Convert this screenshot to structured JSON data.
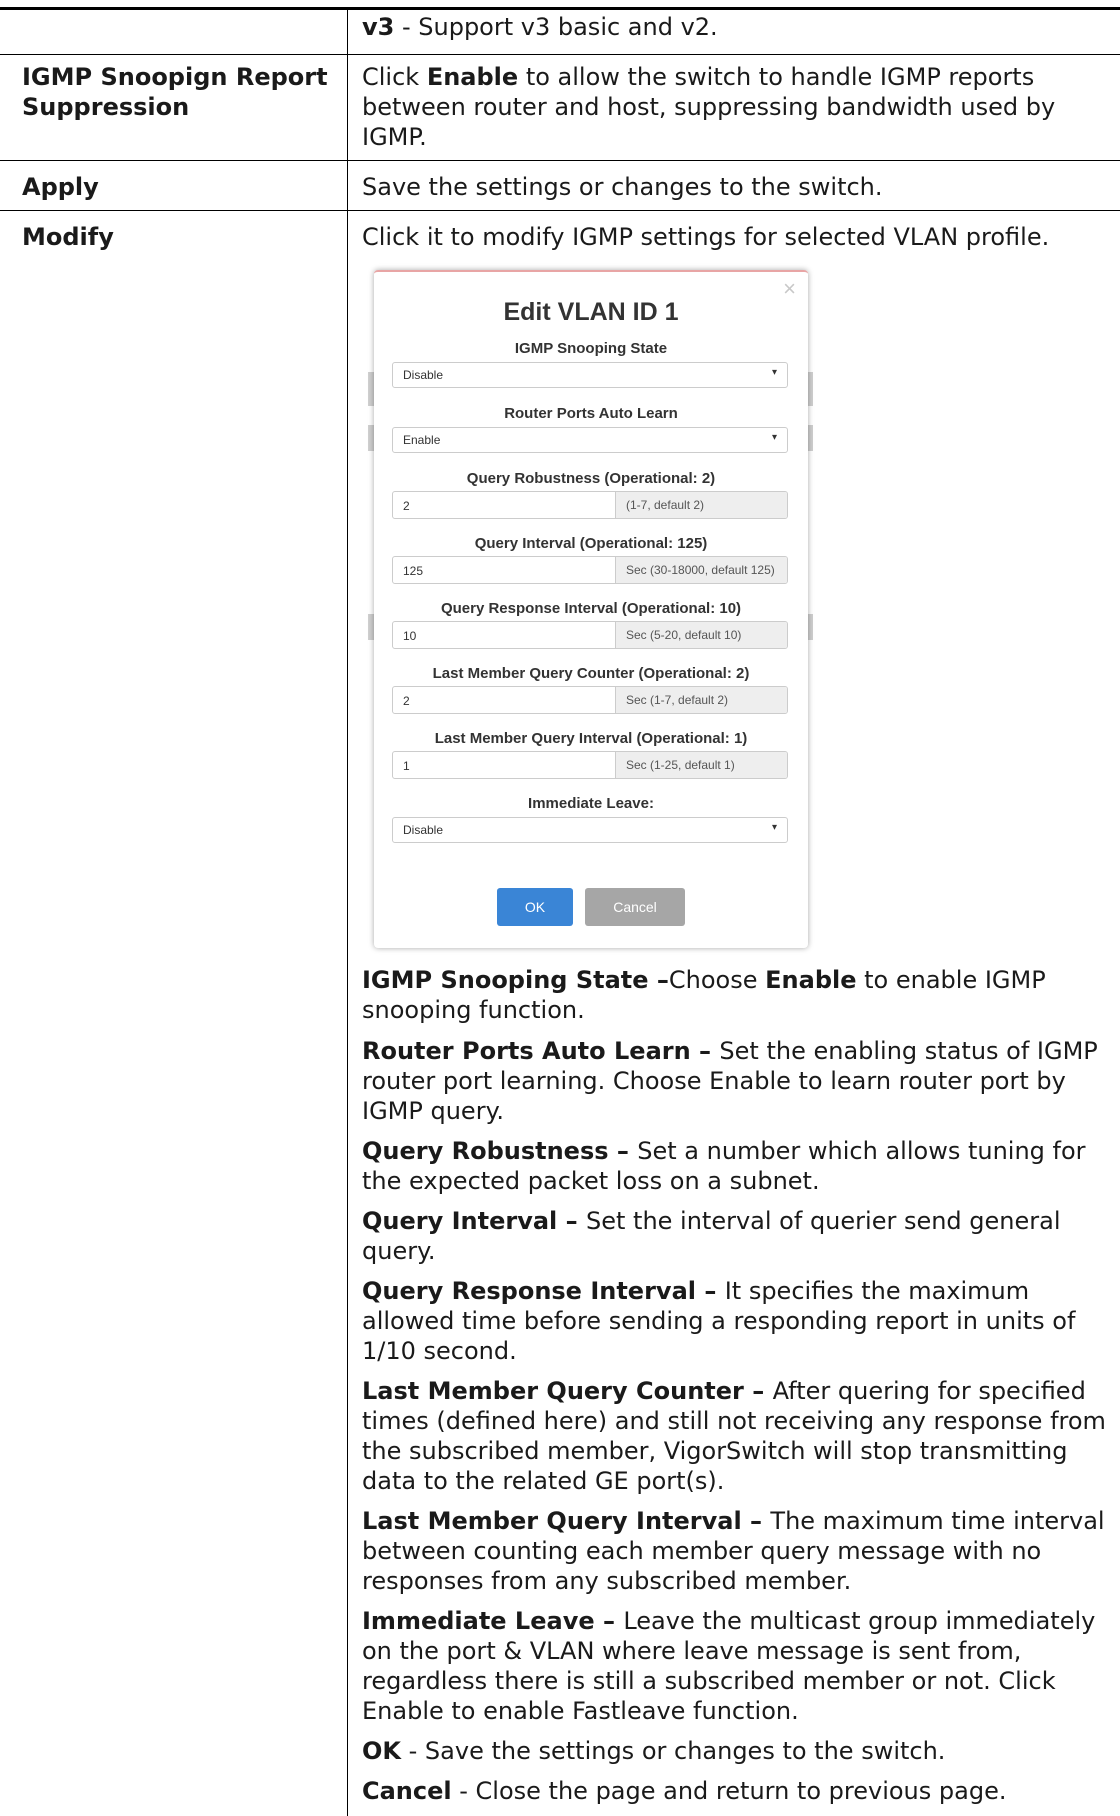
{
  "rows": {
    "versions": {
      "v3_term": "v3",
      "v3_text": " - Support v3 basic and v2."
    },
    "report_suppression": {
      "label": "IGMP Snoopign Report Suppression",
      "desc_pre": "Click ",
      "desc_bold": "Enable",
      "desc_post": " to allow the switch to handle IGMP reports between router and host, suppressing bandwidth used by IGMP."
    },
    "apply": {
      "label": "Apply",
      "desc": "Save the settings or changes to the switch."
    },
    "modify": {
      "label": "Modify",
      "desc": "Click it to modify IGMP settings for selected VLAN profile."
    }
  },
  "dialog": {
    "title": "Edit VLAN ID 1",
    "close": "×",
    "snooping_state": {
      "label": "IGMP Snooping State",
      "value": "Disable"
    },
    "auto_learn": {
      "label": "Router Ports Auto Learn",
      "value": "Enable"
    },
    "robustness": {
      "label": "Query Robustness (Operational: 2)",
      "value": "2",
      "hint": "(1-7, default 2)"
    },
    "interval": {
      "label": "Query Interval (Operational: 125)",
      "value": "125",
      "hint": "Sec (30-18000, default 125)"
    },
    "response": {
      "label": "Query Response Interval (Operational: 10)",
      "value": "10",
      "hint": "Sec (5-20, default 10)"
    },
    "lm_counter": {
      "label": "Last Member Query Counter (Operational: 2)",
      "value": "2",
      "hint": "Sec (1-7, default 2)"
    },
    "lm_interval": {
      "label": "Last Member Query Interval (Operational: 1)",
      "value": "1",
      "hint": "Sec (1-25, default 1)"
    },
    "immediate_leave": {
      "label": "Immediate Leave:",
      "value": "Disable"
    },
    "ok": "OK",
    "cancel": "Cancel"
  },
  "descriptions": [
    {
      "term": "IGMP Snooping State",
      "sep": " –",
      "pre": "Choose ",
      "bold": "Enable",
      "post": " to enable IGMP snooping function."
    },
    {
      "term": "Router Ports Auto Learn",
      "sep": " – ",
      "text": "Set the enabling status of IGMP router port learning. Choose Enable to learn router port by IGMP query."
    },
    {
      "term": "Query Robustness",
      "sep": " – ",
      "text": "Set a number which allows tuning for the expected packet loss on a subnet."
    },
    {
      "term": "Query Interval",
      "sep": " – ",
      "text": "Set the interval of querier send general query."
    },
    {
      "term": "Query Response Interval",
      "sep": " – ",
      "text": "It specifies the maximum allowed time before sending a responding report in units of 1/10 second."
    },
    {
      "term": "Last Member Query Counter",
      "sep": " – ",
      "text": "After quering for specified times (defined here) and still not receiving any response from the subscribed member, VigorSwitch will stop transmitting data to the related GE port(s)."
    },
    {
      "term": "Last Member Query Interval",
      "sep": " – ",
      "text": "The maximum time interval between counting each member query message with no responses from any subscribed member."
    },
    {
      "term": "Immediate Leave",
      "sep": " – ",
      "text": "Leave the multicast group immediately on the port & VLAN where leave message is sent from, regardless there is still a subscribed member or not. Click Enable to enable Fastleave function."
    },
    {
      "term": "OK",
      "sep": " - ",
      "text": "Save the settings or changes to the switch."
    },
    {
      "term": "Cancel",
      "sep": " - ",
      "text": "Close the page and return to previous page."
    }
  ]
}
